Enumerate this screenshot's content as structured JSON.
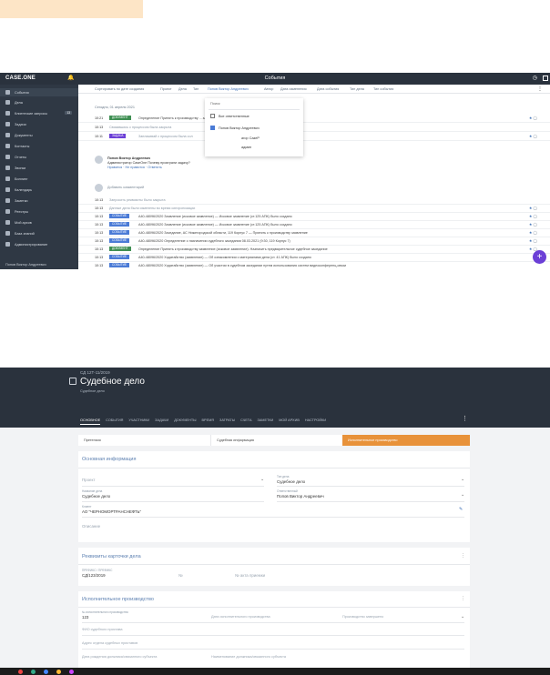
{
  "screen1": {
    "logo": "CASE.ONE",
    "title": "События",
    "sidebar": [
      "События",
      "Дела",
      "Клиентские запросы",
      "Задачи",
      "Документы",
      "Контакты",
      "Отчеты",
      "Звонки",
      "Биллинг",
      "Календарь",
      "Заметки",
      "Реестры",
      "Мой архив",
      "База знаний",
      "Администрирование"
    ],
    "sidebar_badge": "13",
    "sidebar_user": "Попов Виктор Андреевич",
    "filters": [
      "Сортировать по дате создания",
      "Проект",
      "Дела",
      "Тип",
      "Попов Виктор Андреевич",
      "Автор",
      "Дата изменения",
      "Дата события",
      "Тип дела",
      "Тип события"
    ],
    "date_header": "Сегодня, 01 апреля 2021",
    "rows": [
      {
        "time": "10:21",
        "tag": "ДОКУМЕНТ",
        "text": "Определение Принять к производству ... заявлению разбирательстве (ст. 201 АПК) был создан"
      },
      {
        "time": "10:13",
        "tag": "",
        "text": "Связавшись с процессом была закрыта"
      },
      {
        "time": "10:11",
        "tag": "ЗАДАЧА",
        "text": "Заплакивай с процессом была сол"
      }
    ],
    "comment_author": "Попов Виктор Андреевич",
    "comment_text": "Администратор CaseOne Почему проиграли задачу?",
    "comment_reply": "Нравится · Не нравится · Ответить",
    "add_comment": "Добавить комментарий",
    "rows2": [
      {
        "time": "10:13",
        "tag": "",
        "text": "Запросить реквизиты было закрыта"
      },
      {
        "time": "10:13",
        "tag": "",
        "text": "Данные дела были изменены во время синхронизации"
      },
      {
        "time": "10:13",
        "tag": "СОБЫТИЕ",
        "text": "А40-48096/2020 Заявление (исковое заявление) — Исковое заявление (ст.125 АПК) было создано"
      },
      {
        "time": "10:13",
        "tag": "СОБЫТИЕ",
        "text": "А40-48096/2020 Заявление (исковое заявление) — Исковое заявление (ст.125 АПК) было создано"
      },
      {
        "time": "10:13",
        "tag": "СОБЫТИЕ",
        "text": "А40-48096/2020 Заседание, АС Нижегородской области, 119 Корпус 7 — Принять к производству заявление"
      },
      {
        "time": "10:13",
        "tag": "СОБЫТИЕ",
        "text": "А40-48096/2020 Определение о назначении судебного заседания 08.03.2021 (9:30, 119 Корпус 7)"
      },
      {
        "time": "10:13",
        "tag": "ДОКУМЕНТ",
        "text": "Определение Принять к производству заявление (исковое заявление). Назначить предварительное судебное заседание"
      },
      {
        "time": "10:13",
        "tag": "СОБЫТИЕ",
        "text": "А40-48096/2020 Ходатайство (заявление) — Об ознакомлении с материалами дела (ст. 41 АПК) было создано"
      },
      {
        "time": "10:13",
        "tag": "СОБЫТИЕ",
        "text": "А40-48096/2020 Ходатайство (заявление) — Об участии в судебном заседании путем использования систем видеоконференц-связи"
      },
      {
        "time": "10:13",
        "tag": "СОБЫТИЕ",
        "text": "А40-48096/2020 Ходатайство (заявление) — Об участии в судебном заседании путем использования систем видеоконференц-связи"
      }
    ],
    "dropdown": {
      "search": "Поиск",
      "opt1": "Все ответственные",
      "opt2": "Попов Виктор Андреевич",
      "sub1": "агор СазеР",
      "sub2": "админ"
    },
    "fab": "+"
  },
  "screen2": {
    "case_no": "СД 12Т-11/2019",
    "title": "Судебное дело",
    "caption": "Судебное дело",
    "tabs": [
      "ОСНОВНОЕ",
      "СОБЫТИЯ",
      "УЧАСТНИКИ",
      "ЗАДАЧИ",
      "ДОКУМЕНТЫ",
      "ВРЕМЯ",
      "ЗАТРАТЫ",
      "СЧЕТА",
      "ЗАМЕТКИ",
      "МОЙ АРХИВ",
      "НАСТРОЙКИ"
    ],
    "stages": [
      "Претензия",
      "Судебная инфармация",
      "Исполнительное производство"
    ],
    "basic": {
      "title": "Основная информация",
      "project_lbl": "Проект",
      "type_lbl": "Тип дела",
      "type_val": "Судебное дело",
      "name_lbl": "Название дела",
      "name_val": "Судебное дело",
      "resp_lbl": "Ответственный",
      "resp_val": "Попов Виктор Андреевич",
      "client_lbl": "Клиент",
      "client_val": "АО \"ЧЕРНОМОРТРАНСНЕФТЬ\"",
      "desc_lbl": "Описание"
    },
    "req": {
      "title": "Реквизиты карточки дела",
      "num_lbl": "ПРЕФИКС / ПРЕФИКС",
      "num_val": "СД/123/2019",
      "f2": "№",
      "f3": "№ акта приемки"
    },
    "exec": {
      "title": "Исполнительное производство",
      "num_lbl": "№ исполнительного производства",
      "num_val": "123",
      "date_lbl": "Дата исполнительного производства",
      "state_lbl": "Производство завершено",
      "f4": "ФИО судебного пристава",
      "f5": "Адрес отдела судебных приставов",
      "f6": "Дата рождения должника/связанного субъекта",
      "f7": "Наименование должника/связанного субъекта"
    }
  }
}
